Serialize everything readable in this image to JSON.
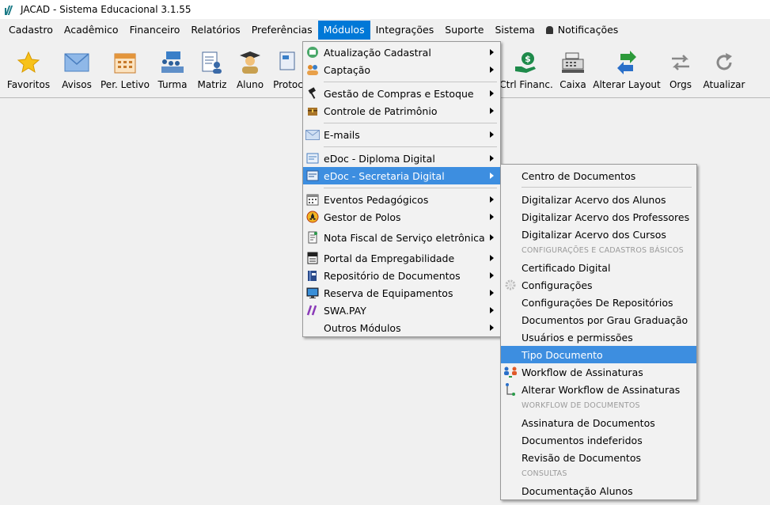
{
  "window": {
    "title": "JACAD - Sistema Educacional 3.1.55"
  },
  "menubar": {
    "items": [
      "Cadastro",
      "Acadêmico",
      "Financeiro",
      "Relatórios",
      "Preferências",
      "Módulos",
      "Integrações",
      "Suporte",
      "Sistema"
    ],
    "notifications": "Notificações"
  },
  "toolbar": {
    "buttons": [
      "Favoritos",
      "Avisos",
      "Per. Letivo",
      "Turma",
      "Matriz",
      "Aluno",
      "Protoc",
      "Ctrl Financ.",
      "Caixa",
      "Alterar Layout",
      "Orgs",
      "Atualizar"
    ]
  },
  "modules_menu": {
    "items": [
      "Atualização Cadastral",
      "Captação",
      "Gestão de Compras e Estoque",
      "Controle de Patrimônio",
      "E-mails",
      "eDoc - Diploma Digital",
      "eDoc - Secretaria Digital",
      "Eventos Pedagógicos",
      "Gestor de Polos",
      "Nota Fiscal de Serviço eletrônica",
      "Portal da Empregabilidade",
      "Repositório de Documentos",
      "Reserva de Equipamentos",
      "SWA.PAY",
      "Outros Módulos"
    ]
  },
  "submenu": {
    "items": [
      "Centro de Documentos",
      "Digitalizar Acervo dos Alunos",
      "Digitalizar Acervo dos Professores",
      "Digitalizar Acervo dos Cursos",
      "Certificado Digital",
      "Configurações",
      "Configurações De Repositórios",
      "Documentos por Grau Graduação",
      "Usuários e permissões",
      "Tipo Documento",
      "Workflow de Assinaturas",
      "Alterar Workflow de Assinaturas",
      "Assinatura de Documentos",
      "Documentos indeferidos",
      "Revisão de Documentos",
      "Documentação Alunos"
    ],
    "headers": [
      "CONFIGURAÇÕES E CADASTROS BÁSICOS",
      "WORKFLOW DE DOCUMENTOS",
      "CONSULTAS"
    ]
  },
  "colors": {
    "menu_highlight": "#0078d7",
    "row_highlight": "#3d8ee0"
  }
}
